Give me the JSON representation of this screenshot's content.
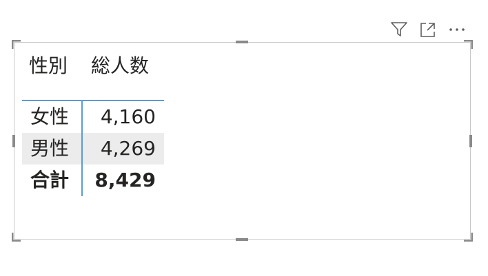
{
  "visual_header": {
    "icons": [
      "filter-icon",
      "focus-mode-icon",
      "more-options-icon"
    ]
  },
  "matrix": {
    "columns": [
      "性別",
      "総人数"
    ],
    "rows": [
      {
        "label": "女性",
        "value": "4,160"
      },
      {
        "label": "男性",
        "value": "4,269"
      }
    ],
    "total": {
      "label": "合計",
      "value": "8,429"
    }
  },
  "colors": {
    "accent_line": "#5b9bd5",
    "row_highlight": "#ececec",
    "border": "#c8c8c8",
    "handle": "#8a8a8a"
  }
}
